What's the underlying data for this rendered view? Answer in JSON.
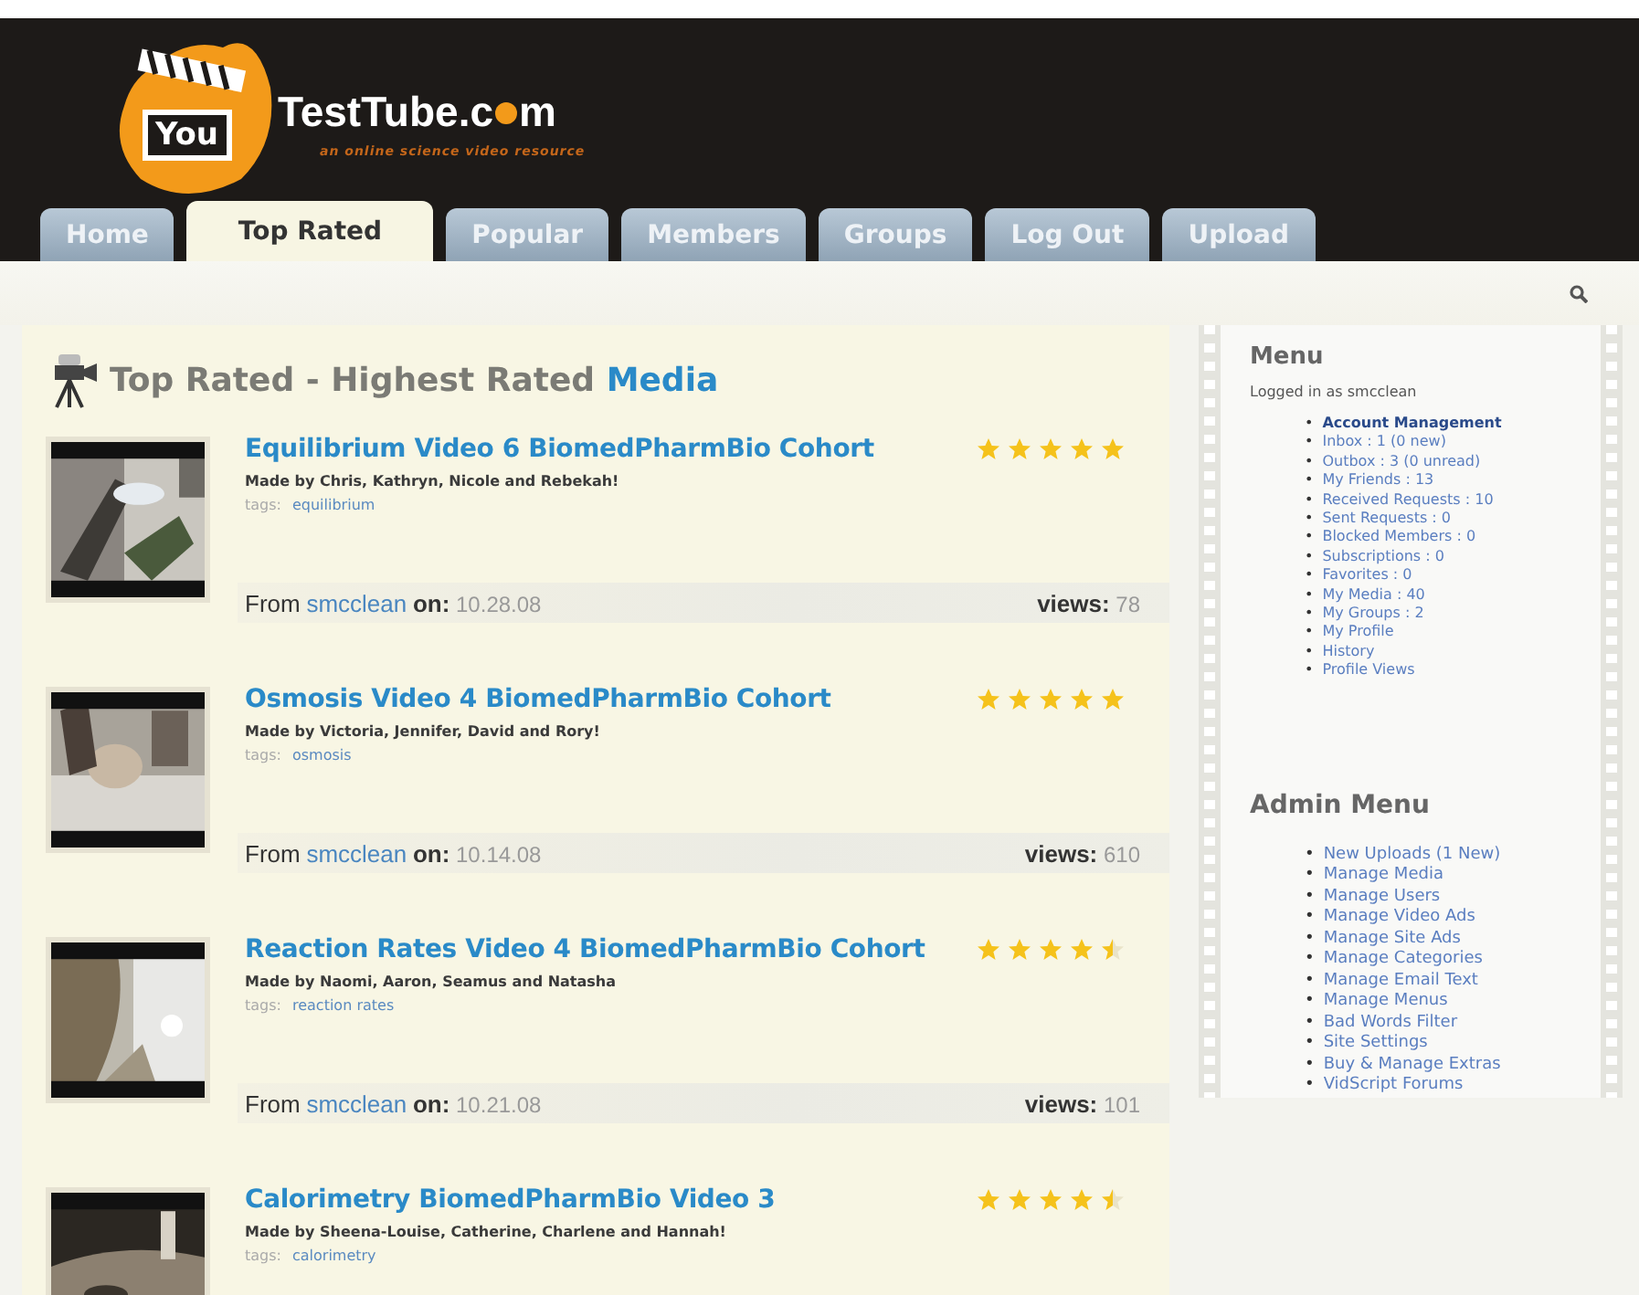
{
  "header": {
    "logo_word": "You",
    "site_name_start": "TestTube.c",
    "site_name_end": "m",
    "tagline": "an online science video resource"
  },
  "tabs": [
    {
      "label": "Home",
      "selected": false
    },
    {
      "label": "Top Rated",
      "selected": true
    },
    {
      "label": "Popular",
      "selected": false
    },
    {
      "label": "Members",
      "selected": false
    },
    {
      "label": "Groups",
      "selected": false
    },
    {
      "label": "Log Out",
      "selected": false
    },
    {
      "label": "Upload",
      "selected": false
    }
  ],
  "main": {
    "title": "Top Rated - Highest Rated",
    "title_highlight": "Media",
    "videos": [
      {
        "title": "Equilibrium Video 6 BiomedPharmBio Cohort",
        "made_by": "Made by Chris, Kathryn, Nicole and Rebekah!",
        "tags_label": "tags:",
        "tag": "equilibrium",
        "stars": 5,
        "from_label": "From",
        "user": "smcclean",
        "on_label": "on:",
        "date": "10.28.08",
        "views_label": "views:",
        "views": "78"
      },
      {
        "title": "Osmosis Video 4 BiomedPharmBio Cohort",
        "made_by": "Made by Victoria, Jennifer, David and Rory!",
        "tags_label": "tags:",
        "tag": "osmosis",
        "stars": 5,
        "from_label": "From",
        "user": "smcclean",
        "on_label": "on:",
        "date": "10.14.08",
        "views_label": "views:",
        "views": "610"
      },
      {
        "title": "Reaction Rates Video 4 BiomedPharmBio Cohort",
        "made_by": "Made by Naomi, Aaron, Seamus and Natasha",
        "tags_label": "tags:",
        "tag": "reaction rates",
        "stars": 4.5,
        "from_label": "From",
        "user": "smcclean",
        "on_label": "on:",
        "date": "10.21.08",
        "views_label": "views:",
        "views": "101"
      },
      {
        "title": "Calorimetry BiomedPharmBio Video 3",
        "made_by": "Made by Sheena-Louise, Catherine, Charlene and Hannah!",
        "tags_label": "tags:",
        "tag": "calorimetry",
        "stars": 4.5
      }
    ]
  },
  "sidebar": {
    "menu_title": "Menu",
    "logged_in": "Logged in as smcclean",
    "menu_items": [
      {
        "bullet": "•",
        "label": "Account Management",
        "kind": "section"
      },
      {
        "bullet": "•",
        "label": "Inbox : 1 (0 new)",
        "kind": "link"
      },
      {
        "bullet": "•",
        "label": "Outbox : 3 (0 unread)",
        "kind": "link"
      },
      {
        "bullet": "•",
        "label": "My Friends : 13",
        "kind": "link"
      },
      {
        "bullet": "•",
        "label": "Received Requests : 10",
        "kind": "link"
      },
      {
        "bullet": "•",
        "label": "Sent Requests : 0",
        "kind": "link"
      },
      {
        "bullet": "•",
        "label": "Blocked Members : 0",
        "kind": "link"
      },
      {
        "bullet": "•",
        "label": "Subscriptions : 0",
        "kind": "link"
      },
      {
        "bullet": "•",
        "label": "Favorites : 0",
        "kind": "link"
      },
      {
        "bullet": "•",
        "label": "My Media : 40",
        "kind": "link"
      },
      {
        "bullet": "•",
        "label": "My Groups : 2",
        "kind": "link"
      },
      {
        "bullet": "•",
        "label": "My Profile",
        "kind": "link"
      },
      {
        "bullet": "•",
        "label": "History",
        "kind": "link"
      },
      {
        "bullet": "•",
        "label": "Profile Views",
        "kind": "link"
      }
    ],
    "admin_title": "Admin Menu",
    "admin_items": [
      {
        "bullet": "•",
        "label": "New Uploads (1 New)"
      },
      {
        "bullet": "•",
        "label": "Manage Media"
      },
      {
        "bullet": "•",
        "label": "Manage Users"
      },
      {
        "bullet": "•",
        "label": "Manage Video Ads"
      },
      {
        "bullet": "•",
        "label": "Manage Site Ads"
      },
      {
        "bullet": "•",
        "label": "Manage Categories"
      },
      {
        "bullet": "•",
        "label": "Manage Email Text"
      },
      {
        "bullet": "•",
        "label": "Manage Menus"
      },
      {
        "bullet": "•",
        "label": "Bad Words Filter"
      },
      {
        "bullet": "•",
        "label": "Site Settings"
      },
      {
        "bullet": "•",
        "label": "Buy & Manage Extras"
      },
      {
        "bullet": "•",
        "label": "VidScript Forums"
      }
    ]
  }
}
